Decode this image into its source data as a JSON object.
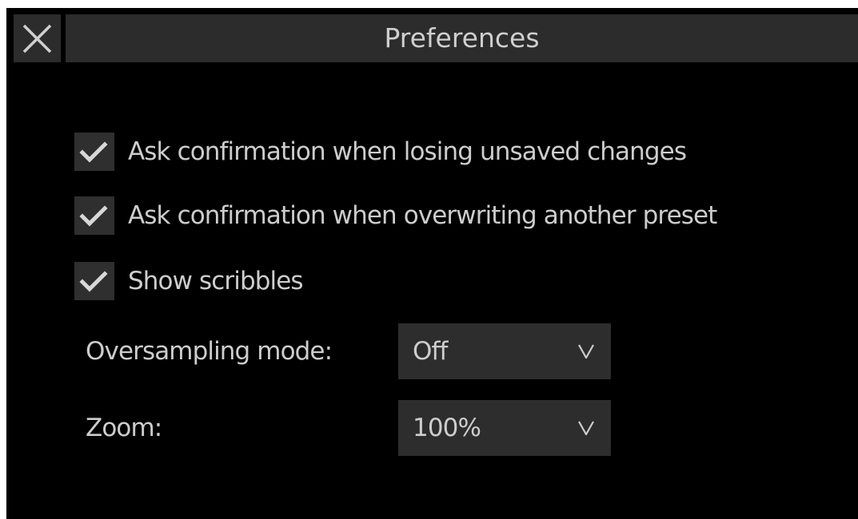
{
  "dialog": {
    "title": "Preferences",
    "close_icon": "close-icon"
  },
  "options": [
    {
      "label": "Ask confirmation when losing unsaved changes",
      "checked": true
    },
    {
      "label": "Ask confirmation when overwriting another preset",
      "checked": true
    },
    {
      "label": "Show scribbles",
      "checked": true
    }
  ],
  "oversampling": {
    "label": "Oversampling mode:",
    "value": "Off"
  },
  "zoom": {
    "label": "Zoom:",
    "value": "100%"
  },
  "colors": {
    "background": "#000000",
    "control": "#2d2d2d",
    "text": "#cdcdcd"
  }
}
